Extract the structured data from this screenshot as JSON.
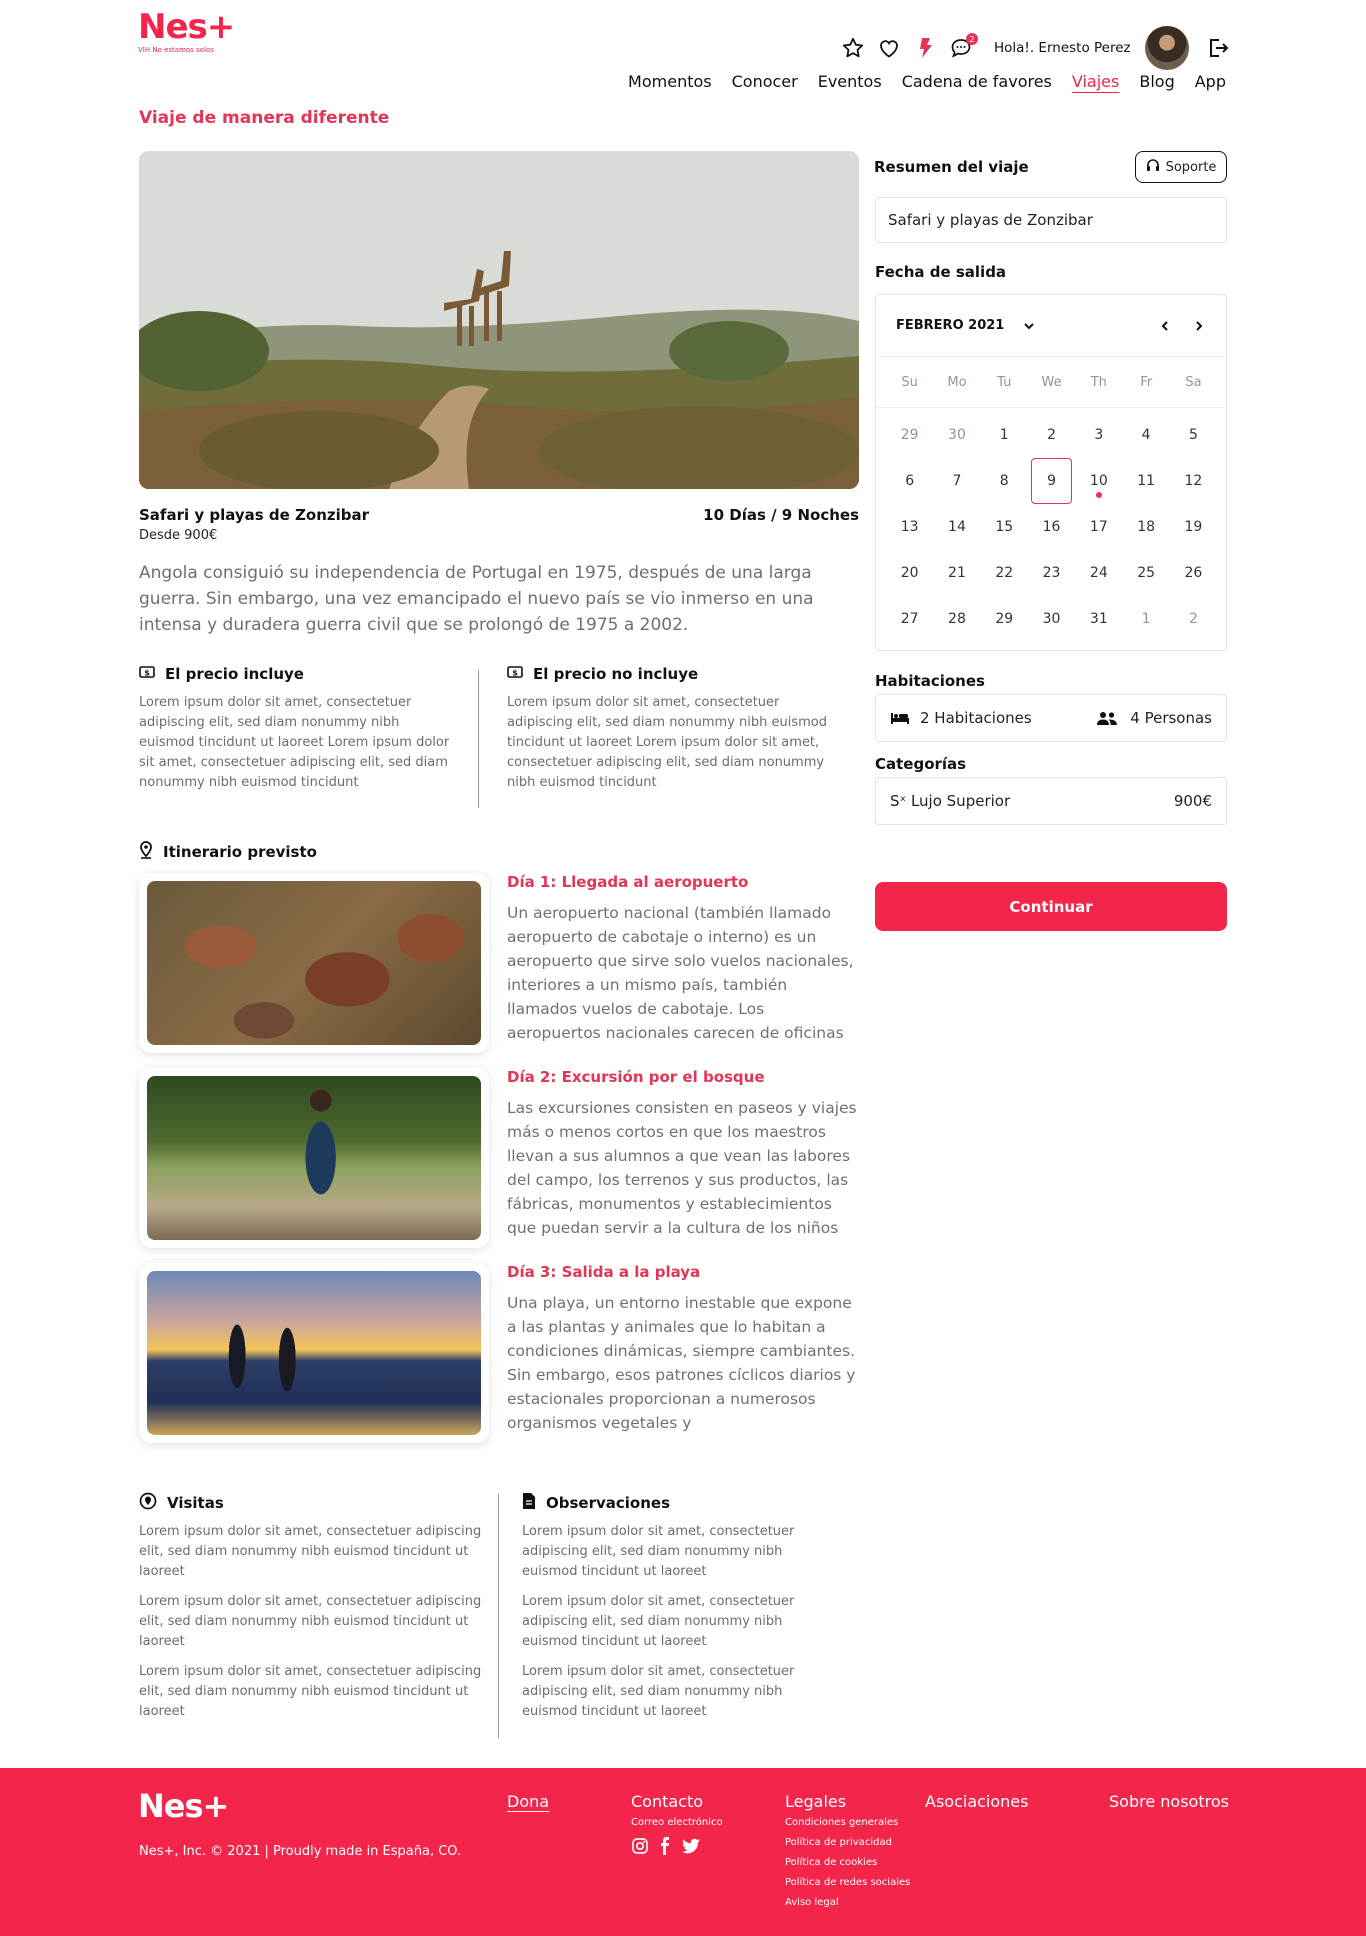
{
  "header": {
    "logo": "Nes+",
    "logo_sub": "VIH No estamos solos",
    "notification_count": "2",
    "greeting": "Hola!. Ernesto Perez",
    "nav": [
      "Momentos",
      "Conocer",
      "Eventos",
      "Cadena de favores",
      "Viajes",
      "Blog",
      "App"
    ],
    "active_nav": "Viajes"
  },
  "page": {
    "title": "Viaje de manera diferente"
  },
  "trip": {
    "name": "Safari y playas de Zonzibar",
    "price_from": "Desde 900€",
    "duration": "10 Días / 9 Noches",
    "description": "Angola consiguió su independencia de Portugal en 1975, después de una larga guerra. Sin embargo, una vez emancipado el nuevo país se vio inmerso en una intensa y duradera guerra civil que se prolongó de 1975 a 2002.",
    "includes_title": "El precio incluye",
    "includes_text": "Lorem ipsum dolor sit amet, consectetuer adipiscing elit, sed diam nonummy nibh euismod tincidunt ut laoreet Lorem ipsum dolor sit amet, consectetuer adipiscing elit, sed diam nonummy nibh euismod tincidunt",
    "excludes_title": "El precio no incluye",
    "excludes_text": "Lorem ipsum dolor sit amet, consectetuer adipiscing elit, sed diam nonummy nibh euismod tincidunt ut laoreet Lorem ipsum dolor sit amet, consectetuer adipiscing elit, sed diam nonummy nibh euismod tincidunt"
  },
  "itinerary": {
    "title": "Itinerario previsto",
    "days": [
      {
        "title": "Día 1: Llegada al aeropuerto",
        "text": "Un aeropuerto nacional (también llamado aeropuerto de cabotaje o interno) es un aeropuerto que sirve solo vuelos nacionales, interiores a un mismo país, también llamados vuelos de cabotaje. Los aeropuertos nacionales carecen de oficinas"
      },
      {
        "title": "Día 2: Excursión por el bosque",
        "text": "Las excursiones consisten en paseos y viajes más o menos cortos en que los maestros llevan a sus alumnos a que vean las labores del campo, los terrenos y sus productos, las fábricas, monumentos y establecimientos que puedan servir a la cultura de los niños"
      },
      {
        "title": "Día 3: Salida a la playa",
        "text": "Una playa, un entorno inestable que expone a las plantas y animales que lo habitan a condiciones dinámicas, siempre cambiantes. Sin embargo, esos patrones cíclicos diarios y estacionales proporcionan a numerosos organismos vegetales y"
      }
    ]
  },
  "visits": {
    "title": "Visitas",
    "items": [
      "Lorem ipsum dolor sit amet, consectetuer adipiscing elit, sed diam nonummy nibh euismod tincidunt ut laoreet",
      "Lorem ipsum dolor sit amet, consectetuer adipiscing elit, sed diam nonummy nibh euismod tincidunt ut laoreet",
      "Lorem ipsum dolor sit amet, consectetuer adipiscing elit, sed diam nonummy nibh euismod tincidunt ut laoreet"
    ]
  },
  "observations": {
    "title": "Observaciones",
    "items": [
      "Lorem ipsum dolor sit amet, consectetuer adipiscing elit, sed diam nonummy nibh euismod tincidunt ut laoreet",
      "Lorem ipsum dolor sit amet, consectetuer adipiscing elit, sed diam nonummy nibh euismod tincidunt ut laoreet",
      "Lorem ipsum dolor sit amet, consectetuer adipiscing elit, sed diam nonummy nibh euismod tincidunt ut laoreet"
    ]
  },
  "summary": {
    "title": "Resumen del viaje",
    "support_label": "Soporte",
    "trip_value": "Safari y playas de Zonzibar",
    "date_label": "Fecha de salida",
    "calendar": {
      "month": "FEBRERO 2021",
      "weekdays": [
        "Su",
        "Mo",
        "Tu",
        "We",
        "Th",
        "Fr",
        "Sa"
      ],
      "days": [
        "29",
        "30",
        "1",
        "2",
        "3",
        "4",
        "5",
        "6",
        "7",
        "8",
        "9",
        "10",
        "11",
        "12",
        "13",
        "14",
        "15",
        "16",
        "17",
        "18",
        "19",
        "20",
        "21",
        "22",
        "23",
        "24",
        "25",
        "26",
        "27",
        "28",
        "29",
        "30",
        "31",
        "1",
        "2"
      ],
      "selected": "9",
      "marked": "10"
    },
    "rooms_label": "Habitaciones",
    "rooms_value": "2 Habitaciones",
    "persons_value": "4 Personas",
    "categories_label": "Categorías",
    "category_name": "Sˣ Lujo Superior",
    "category_price": "900€",
    "continue_label": "Continuar"
  },
  "footer": {
    "logo": "Nes+",
    "copyright": "Nes+, Inc. © 2021 | Proudly made in España, CO.",
    "dona": "Dona",
    "contacto": "Contacto",
    "contacto_sub": "Correo electrónico",
    "legales": "Legales",
    "legales_links": [
      "Condiciones generales",
      "Política de privacidad",
      "Política de cookies",
      "Política de redes sociales",
      "Aviso legal"
    ],
    "asociaciones": "Asociaciones",
    "sobre": "Sobre nosotros"
  },
  "colors": {
    "brand": "#f4254b",
    "accent_text": "#e43556"
  }
}
